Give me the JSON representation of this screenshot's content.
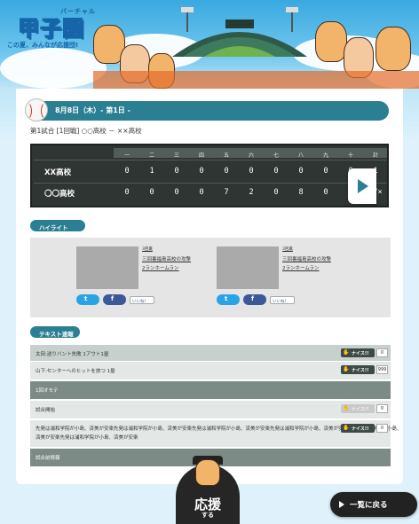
{
  "brand": {
    "ruby": "バーチャル",
    "name": "甲子園",
    "tagline": "この夏、みんなが応援団!"
  },
  "match": {
    "date": "8月8日（木）- 第1日 -",
    "title": "第1試合 [1回戦] ○○高校 － ××高校"
  },
  "scoreboard": {
    "innings": [
      "一",
      "二",
      "三",
      "四",
      "五",
      "六",
      "七",
      "八",
      "九",
      "十",
      "計"
    ],
    "teams": [
      {
        "name": "XX高校",
        "scores": [
          "0",
          "1",
          "0",
          "0",
          "0",
          "0",
          "0",
          "0",
          "0",
          "0",
          "1"
        ]
      },
      {
        "name": "〇〇高校",
        "scores": [
          "0",
          "0",
          "0",
          "0",
          "7",
          "2",
          "0",
          "8",
          "0",
          "×",
          "17×"
        ]
      }
    ]
  },
  "highlight": {
    "section_label": "ハイライト",
    "items": [
      {
        "inning": "3回裏",
        "play": "三回裏福島高校の攻撃",
        "desc": "2ランホームラン",
        "like": "いいね！"
      },
      {
        "inning": "3回裏",
        "play": "三回裏福島高校の攻撃",
        "desc": "2ランホームラン",
        "like": "いいね！"
      }
    ],
    "sns_twitter_icon": "twitter-icon",
    "sns_facebook_icon": "facebook-icon"
  },
  "text_live": {
    "section_label": "テキスト速報",
    "nice_label": "ナイス!!",
    "rows": [
      {
        "text": "太田:送りバント失敗 1アウト1塁",
        "nice": true,
        "count": "0",
        "style": "gray"
      },
      {
        "text": "山下:センターへのヒットを放つ 1塁",
        "nice": true,
        "count": "999",
        "style": "light"
      },
      {
        "text": "1回オモテ",
        "nice": false,
        "count": "",
        "style": "dark"
      },
      {
        "text": "試合開始",
        "nice": true,
        "count": "0",
        "style": "light",
        "disabled": true
      },
      {
        "text": "先発は浦和学院が小島、済美が安楽先発は浦和学院が小島、済美が安楽先発は浦和学院が小島、済美が安楽先発は浦和学院が小島、済美が安楽先発は浦和学院が小島、",
        "text2": "済美が安楽先発は浦和学院が小島、済美が安楽",
        "nice": true,
        "count": "0",
        "style": "light"
      },
      {
        "text": "試合前情報",
        "nice": false,
        "count": "",
        "style": "dark"
      }
    ]
  },
  "footer": {
    "ouen_label": "応援",
    "ouen_sub": "する",
    "back_label": "一覧に戻る"
  },
  "colors": {
    "accent": "#2b7f92",
    "scoreboard": "#2e3533",
    "button_dark": "#222222"
  }
}
